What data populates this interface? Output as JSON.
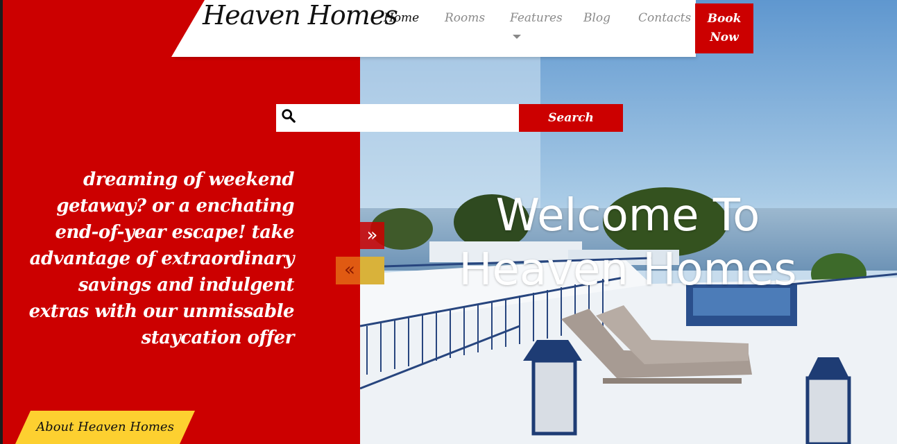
{
  "header": {
    "logo": "Heaven Homes",
    "nav": [
      "Home",
      "Rooms",
      "Features",
      "Blog",
      "Contacts"
    ],
    "book_line1": "Book",
    "book_line2": "Now"
  },
  "search": {
    "placeholder": "",
    "value": "",
    "button_label": "Search"
  },
  "hero": {
    "tagline": "dreaming of weekend getaway? or a enchating end-of-year escape! take advantage of extraordinary savings and indulgent extras with our unmissable staycation offer",
    "welcome_line1": "Welcome To",
    "welcome_line2": "Heaven Homes",
    "next_arrow": "»",
    "prev_arrow": "«"
  },
  "about_button": "About Heaven Homes",
  "colors": {
    "brand_red": "#cc0000",
    "accent_yellow": "#fdd030"
  },
  "icons": [
    "search-icon",
    "chevron-down-icon",
    "double-chevron-right-icon",
    "double-chevron-left-icon"
  ]
}
